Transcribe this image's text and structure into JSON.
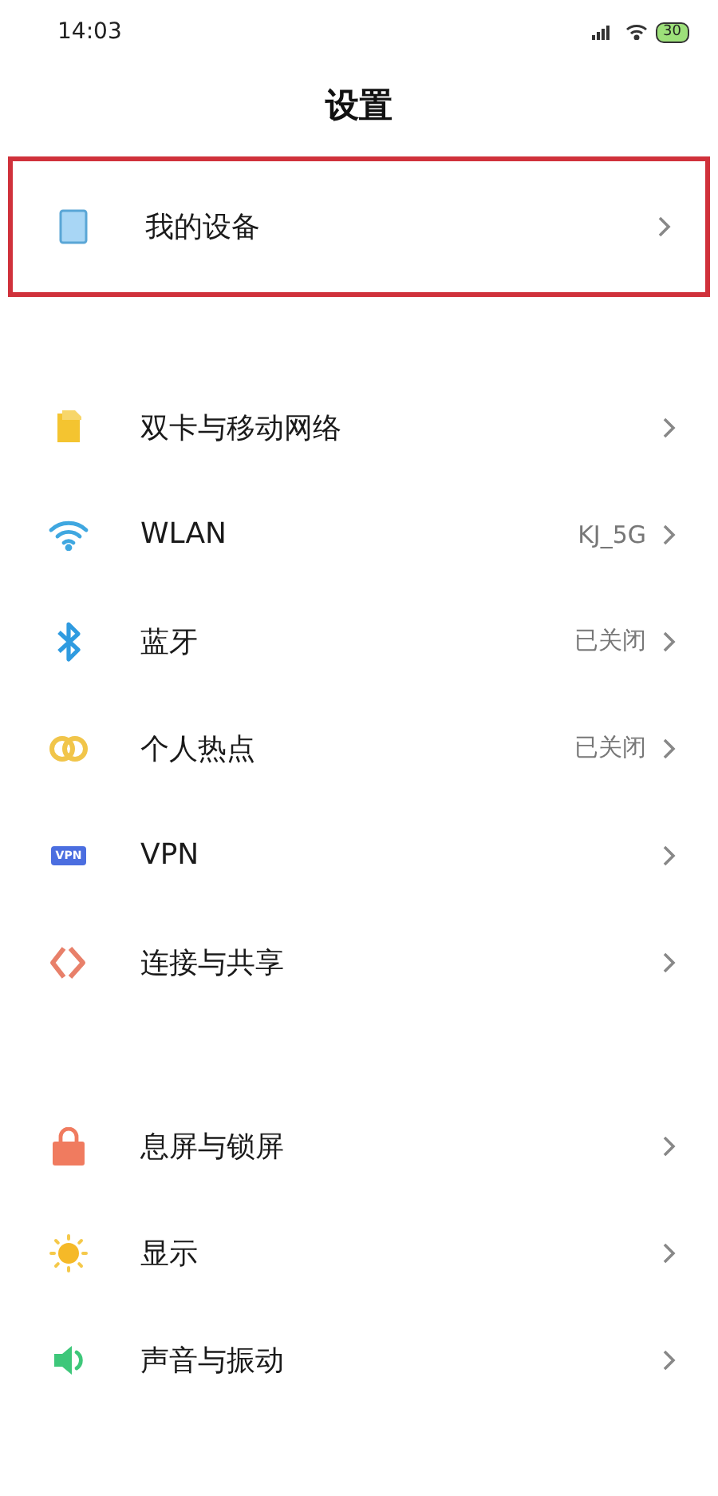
{
  "status_bar": {
    "time": "14:03",
    "battery": "30"
  },
  "title": "设置",
  "sections": [
    {
      "items": [
        {
          "kind": "device",
          "label": "我的设备",
          "highlighted": true
        }
      ]
    },
    {
      "items": [
        {
          "kind": "sim",
          "label": "双卡与移动网络",
          "highlighted": false
        },
        {
          "kind": "wifi",
          "label": "WLAN",
          "value": "KJ_5G",
          "highlighted": false
        },
        {
          "kind": "bluetooth",
          "label": "蓝牙",
          "value": "已关闭",
          "highlighted": false
        },
        {
          "kind": "hotspot",
          "label": "个人热点",
          "value": "已关闭",
          "highlighted": false
        },
        {
          "kind": "vpn",
          "label": "VPN",
          "badge": "VPN",
          "highlighted": false
        },
        {
          "kind": "share",
          "label": "连接与共享",
          "highlighted": false
        }
      ]
    },
    {
      "items": [
        {
          "kind": "lock",
          "label": "息屏与锁屏",
          "highlighted": false
        },
        {
          "kind": "display",
          "label": "显示",
          "highlighted": false
        },
        {
          "kind": "sound",
          "label": "声音与振动",
          "highlighted": false
        }
      ]
    }
  ]
}
